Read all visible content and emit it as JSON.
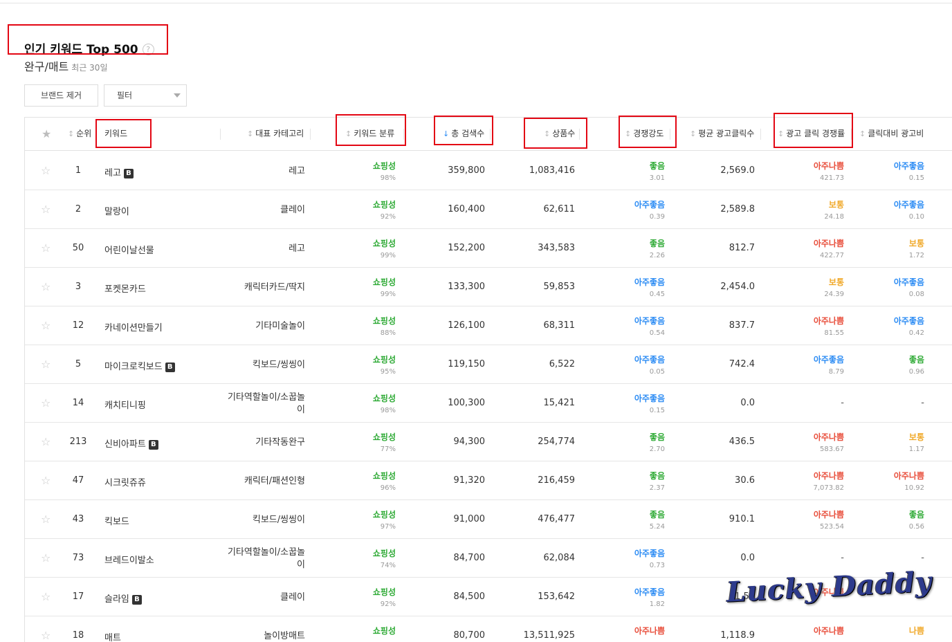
{
  "header": {
    "title": "인기 키워드 Top 500",
    "help_icon": "?",
    "category": "완구/매트",
    "period": "최근 30일"
  },
  "toolbar": {
    "brand_remove_label": "브랜드 제거",
    "filter_label": "필터"
  },
  "columns": {
    "rank": "순위",
    "keyword": "키워드",
    "category": "대표 카테고리",
    "keyword_type": "키워드 분류",
    "total_search": "총 검색수",
    "product_count": "상품수",
    "competition": "경쟁강도",
    "avg_ad_clicks": "평균 광고클릭수",
    "ad_click_competition": "광고 클릭 경쟁률",
    "ad_cost_ratio": "클릭대비 광고비"
  },
  "sort_icons": {
    "idle": "↕",
    "active_desc": "↓"
  },
  "brand_badge": "B",
  "colors": {
    "good_green": "#2eaa35",
    "very_good_blue": "#2c8cf4",
    "very_bad_red": "#e84e3b",
    "normal_yellow": "#f0a92a",
    "highlight_box": "#e30613"
  },
  "rows": [
    {
      "rank": "1",
      "keyword": "레고",
      "brand": true,
      "category": [
        "레고"
      ],
      "type": "쇼핑성",
      "type_pct": "98%",
      "search": "359,800",
      "products": "1,083,416",
      "comp": "좋음",
      "comp_val": "3.01",
      "comp_color": "green",
      "clicks": "2,569.0",
      "adcomp": "아주나쁨",
      "adcomp_val": "421.73",
      "adcomp_color": "red",
      "cost": "아주좋음",
      "cost_val": "0.15",
      "cost_color": "blue"
    },
    {
      "rank": "2",
      "keyword": "말랑이",
      "brand": false,
      "category": [
        "클레이"
      ],
      "type": "쇼핑성",
      "type_pct": "92%",
      "search": "160,400",
      "products": "62,611",
      "comp": "아주좋음",
      "comp_val": "0.39",
      "comp_color": "blue",
      "clicks": "2,589.8",
      "adcomp": "보통",
      "adcomp_val": "24.18",
      "adcomp_color": "yellow",
      "cost": "아주좋음",
      "cost_val": "0.10",
      "cost_color": "blue"
    },
    {
      "rank": "50",
      "keyword": "어린이날선물",
      "brand": false,
      "category": [
        "레고"
      ],
      "type": "쇼핑성",
      "type_pct": "99%",
      "search": "152,200",
      "products": "343,583",
      "comp": "좋음",
      "comp_val": "2.26",
      "comp_color": "green",
      "clicks": "812.7",
      "adcomp": "아주나쁨",
      "adcomp_val": "422.77",
      "adcomp_color": "red",
      "cost": "보통",
      "cost_val": "1.72",
      "cost_color": "yellow"
    },
    {
      "rank": "3",
      "keyword": "포켓몬카드",
      "brand": false,
      "category": [
        "캐릭터카드/딱지"
      ],
      "type": "쇼핑성",
      "type_pct": "99%",
      "search": "133,300",
      "products": "59,853",
      "comp": "아주좋음",
      "comp_val": "0.45",
      "comp_color": "blue",
      "clicks": "2,454.0",
      "adcomp": "보통",
      "adcomp_val": "24.39",
      "adcomp_color": "yellow",
      "cost": "아주좋음",
      "cost_val": "0.08",
      "cost_color": "blue"
    },
    {
      "rank": "12",
      "keyword": "카네이션만들기",
      "brand": false,
      "category": [
        "기타미술놀이"
      ],
      "type": "쇼핑성",
      "type_pct": "88%",
      "search": "126,100",
      "products": "68,311",
      "comp": "아주좋음",
      "comp_val": "0.54",
      "comp_color": "blue",
      "clicks": "837.7",
      "adcomp": "아주나쁨",
      "adcomp_val": "81.55",
      "adcomp_color": "red",
      "cost": "아주좋음",
      "cost_val": "0.42",
      "cost_color": "blue"
    },
    {
      "rank": "5",
      "keyword": "마이크로킥보드",
      "brand": true,
      "category": [
        "킥보드/씽씽이"
      ],
      "type": "쇼핑성",
      "type_pct": "95%",
      "search": "119,150",
      "products": "6,522",
      "comp": "아주좋음",
      "comp_val": "0.05",
      "comp_color": "blue",
      "clicks": "742.4",
      "adcomp": "아주좋음",
      "adcomp_val": "8.79",
      "adcomp_color": "blue",
      "cost": "좋음",
      "cost_val": "0.96",
      "cost_color": "green"
    },
    {
      "rank": "14",
      "keyword": "캐치티니핑",
      "brand": false,
      "category": [
        "기타역할놀이/소꿉놀",
        "이"
      ],
      "type": "쇼핑성",
      "type_pct": "98%",
      "search": "100,300",
      "products": "15,421",
      "comp": "아주좋음",
      "comp_val": "0.15",
      "comp_color": "blue",
      "clicks": "0.0",
      "adcomp": "-",
      "adcomp_val": "",
      "adcomp_color": "",
      "cost": "-",
      "cost_val": "",
      "cost_color": ""
    },
    {
      "rank": "213",
      "keyword": "신비아파트",
      "brand": true,
      "category": [
        "기타작동완구"
      ],
      "type": "쇼핑성",
      "type_pct": "77%",
      "search": "94,300",
      "products": "254,774",
      "comp": "좋음",
      "comp_val": "2.70",
      "comp_color": "green",
      "clicks": "436.5",
      "adcomp": "아주나쁨",
      "adcomp_val": "583.67",
      "adcomp_color": "red",
      "cost": "보통",
      "cost_val": "1.17",
      "cost_color": "yellow"
    },
    {
      "rank": "47",
      "keyword": "시크릿쥬쥬",
      "brand": false,
      "category": [
        "캐릭터/패션인형"
      ],
      "type": "쇼핑성",
      "type_pct": "96%",
      "search": "91,320",
      "products": "216,459",
      "comp": "좋음",
      "comp_val": "2.37",
      "comp_color": "green",
      "clicks": "30.6",
      "adcomp": "아주나쁨",
      "adcomp_val": "7,073.82",
      "adcomp_color": "red",
      "cost": "아주나쁨",
      "cost_val": "10.92",
      "cost_color": "red"
    },
    {
      "rank": "43",
      "keyword": "킥보드",
      "brand": false,
      "category": [
        "킥보드/씽씽이"
      ],
      "type": "쇼핑성",
      "type_pct": "97%",
      "search": "91,000",
      "products": "476,477",
      "comp": "좋음",
      "comp_val": "5.24",
      "comp_color": "green",
      "clicks": "910.1",
      "adcomp": "아주나쁨",
      "adcomp_val": "523.54",
      "adcomp_color": "red",
      "cost": "좋음",
      "cost_val": "0.56",
      "cost_color": "green"
    },
    {
      "rank": "73",
      "keyword": "브레드이발소",
      "brand": false,
      "category": [
        "기타역할놀이/소꿉놀",
        "이"
      ],
      "type": "쇼핑성",
      "type_pct": "74%",
      "search": "84,700",
      "products": "62,084",
      "comp": "아주좋음",
      "comp_val": "0.73",
      "comp_color": "blue",
      "clicks": "0.0",
      "adcomp": "-",
      "adcomp_val": "",
      "adcomp_color": "",
      "cost": "-",
      "cost_val": "",
      "cost_color": ""
    },
    {
      "rank": "17",
      "keyword": "슬라임",
      "brand": true,
      "category": [
        "클레이"
      ],
      "type": "쇼핑성",
      "type_pct": "92%",
      "search": "84,500",
      "products": "153,642",
      "comp": "아주좋음",
      "comp_val": "1.82",
      "comp_color": "blue",
      "clicks": "1,54",
      "adcomp": "아주나쁨",
      "adcomp_val": "",
      "adcomp_color": "red",
      "cost": "",
      "cost_val": "",
      "cost_color": "blue"
    },
    {
      "rank": "18",
      "keyword": "매트",
      "brand": false,
      "category": [
        "놀이방매트"
      ],
      "type": "쇼핑성",
      "type_pct": "",
      "search": "80,700",
      "products": "13,511,925",
      "comp": "아주나쁨",
      "comp_val": "",
      "comp_color": "red",
      "clicks": "1,118.9",
      "adcomp": "아주나쁨",
      "adcomp_val": "",
      "adcomp_color": "red",
      "cost": "나쁨",
      "cost_val": "",
      "cost_color": "yellow"
    }
  ],
  "watermark": "Lucky Daddy"
}
